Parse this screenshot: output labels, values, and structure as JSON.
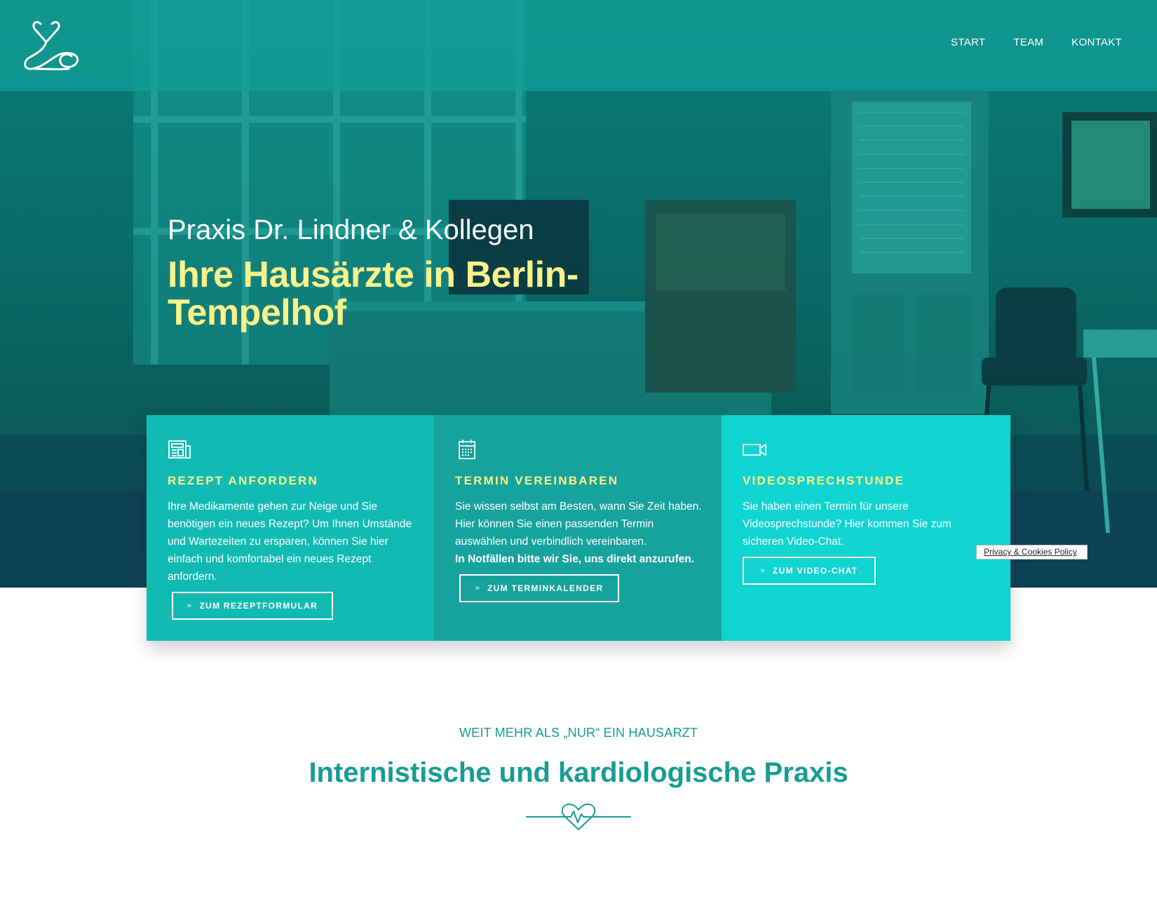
{
  "header": {
    "logo_label": "Praxis Dr. Lindner & Kollegen",
    "nav": [
      "START",
      "TEAM",
      "KONTAKT"
    ]
  },
  "hero": {
    "subtitle": "Praxis Dr. Lindner & Kollegen",
    "title": "Ihre Hausärzte in Berlin-Tempelhof"
  },
  "cards": [
    {
      "icon": "newspaper-icon",
      "title": "REZEPT ANFORDERN",
      "text": "Ihre Medikamente gehen zur Neige und Sie benötigen ein neues Rezept? Um Ihnen Umstände und Wartezeiten zu ersparen, können Sie hier einfach und komfortabel ein neues Rezept anfordern.",
      "bold": "",
      "button": "ZUM REZEPTFORMULAR"
    },
    {
      "icon": "calendar-icon",
      "title": "TERMIN VEREINBAREN",
      "text": "Sie wissen selbst am Besten, wann Sie Zeit haben. Hier können Sie einen passenden Termin auswählen und verbindlich vereinbaren.",
      "bold": "In Notfällen bitte wir Sie, uns direkt anzurufen.",
      "button": "ZUM TERMINKALENDER"
    },
    {
      "icon": "video-camera-icon",
      "title": "VIDEOSPRECHSTUNDE",
      "text": "Sie haben einen Termin für unsere Videosprechstunde? Hier kommen Sie zum sicheren Video-Chat.",
      "bold": "",
      "button": "ZUM VIDEO-CHAT"
    }
  ],
  "cookie_badge": "Privacy & Cookies Policy",
  "section": {
    "kicker": "WEIT MEHR ALS „NUR“ EIN HAUSARZT",
    "title": "Internistische und kardiologische Praxis",
    "divider_icon": "heartbeat-icon"
  },
  "colors": {
    "accent": "#179c95",
    "highlight": "#fdf28a",
    "card_1": "#11bbb3",
    "card_2": "#16a39d",
    "card_3": "#0fd4cf"
  }
}
